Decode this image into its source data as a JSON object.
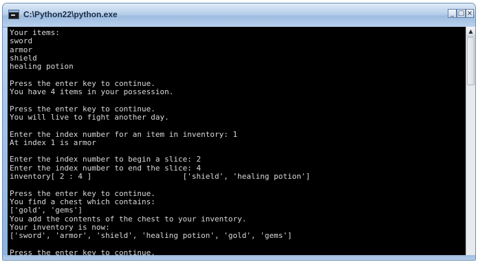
{
  "window": {
    "title": "C:\\Python22\\python.exe",
    "minimize_symbol": "_",
    "maximize_symbol": "□",
    "close_symbol": "×"
  },
  "scrollbar": {
    "up_symbol": "▲"
  },
  "console": {
    "lines": [
      "Your items:",
      "sword",
      "armor",
      "shield",
      "healing potion",
      "",
      "Press the enter key to continue.",
      "You have 4 items in your possession.",
      "",
      "Press the enter key to continue.",
      "You will live to fight another day.",
      "",
      "Enter the index number for an item in inventory: 1",
      "At index 1 is armor",
      "",
      "Enter the index number to begin a slice: 2",
      "Enter the index number to end the slice: 4",
      "inventory[ 2 : 4 ]                    ['shield', 'healing potion']",
      "",
      "Press the enter key to continue.",
      "You find a chest which contains:",
      "['gold', 'gems']",
      "You add the contents of the chest to your inventory.",
      "Your inventory is now:",
      "['sword', 'armor', 'shield', 'healing potion', 'gold', 'gems']",
      "",
      "Press the enter key to continue."
    ]
  }
}
